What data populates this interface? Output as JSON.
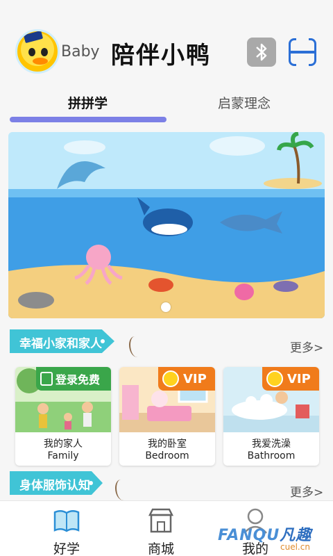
{
  "header": {
    "baby_label": "Baby",
    "app_title": "陪伴小鸭"
  },
  "tabs": [
    {
      "label": "拼拼学",
      "active": true
    },
    {
      "label": "启蒙理念",
      "active": false
    }
  ],
  "banner": {
    "scene": "ocean-illustration",
    "slide_count": 1,
    "active_slide": 1
  },
  "sections": [
    {
      "tag": "幸福小家和家人",
      "more": "更多>",
      "cards": [
        {
          "cn": "我的家人",
          "en": "Family",
          "badge": "登录免费",
          "badge_type": "login"
        },
        {
          "cn": "我的卧室",
          "en": "Bedroom",
          "badge": "VIP",
          "badge_type": "vip"
        },
        {
          "cn": "我爱洗澡",
          "en": "Bathroom",
          "badge": "VIP",
          "badge_type": "vip"
        }
      ]
    },
    {
      "tag": "身体服饰认知",
      "more": "更多>"
    }
  ],
  "bottom_nav": [
    {
      "label": "好学",
      "icon": "book-icon",
      "active": true
    },
    {
      "label": "商城",
      "icon": "store-icon",
      "active": false
    },
    {
      "label": "我的",
      "icon": "profile-icon",
      "active": false
    }
  ],
  "watermark": {
    "brand": "FANQU",
    "cn": "凡趣",
    "site": "cuel.cn"
  },
  "colors": {
    "accent_tab": "#7c80e6",
    "section_tag": "#40c4d6",
    "vip_badge": "#f07b1b",
    "login_badge": "#3aa64a",
    "nav_active": "#2b8fd6"
  }
}
